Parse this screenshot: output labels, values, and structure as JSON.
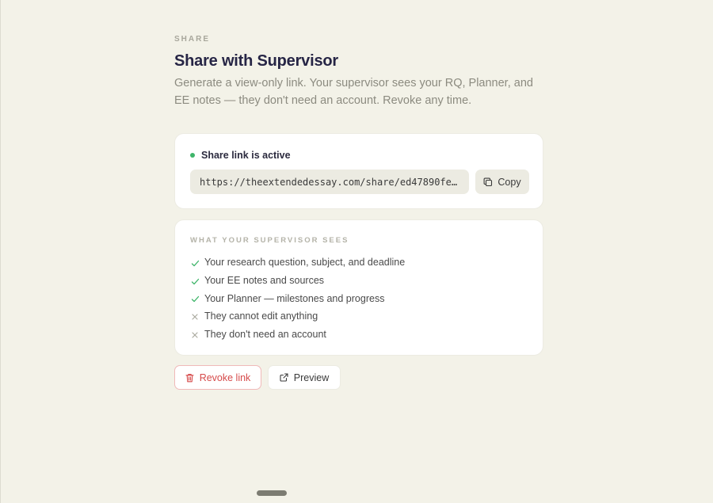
{
  "header": {
    "eyebrow": "SHARE",
    "title": "Share with Supervisor",
    "subtitle": "Generate a view-only link. Your supervisor sees your RQ, Planner, and EE notes — they don't need an account. Revoke any time."
  },
  "share_link": {
    "status_text": "Share link is active",
    "status_color": "#3fb56a",
    "url": "https://theextendedessay.com/share/ed47890fe28a…",
    "copy_label": "Copy",
    "copy_icon": "copy-icon"
  },
  "supervisor_sees": {
    "heading": "WHAT YOUR SUPERVISOR SEES",
    "items": [
      {
        "label": "Your research question, subject, and deadline",
        "allowed": true,
        "icon": "check-icon"
      },
      {
        "label": "Your EE notes and sources",
        "allowed": true,
        "icon": "check-icon"
      },
      {
        "label": "Your Planner — milestones and progress",
        "allowed": true,
        "icon": "check-icon"
      },
      {
        "label": "They cannot edit anything",
        "allowed": false,
        "icon": "cross-icon"
      },
      {
        "label": "They don't need an account",
        "allowed": false,
        "icon": "cross-icon"
      }
    ]
  },
  "actions": {
    "revoke_label": "Revoke link",
    "revoke_icon": "trash-icon",
    "preview_label": "Preview",
    "preview_icon": "external-link-icon"
  },
  "colors": {
    "background": "#f3f2e8",
    "danger": "#d64a4a",
    "check": "#3fb56a",
    "cross": "#a8a79c"
  }
}
